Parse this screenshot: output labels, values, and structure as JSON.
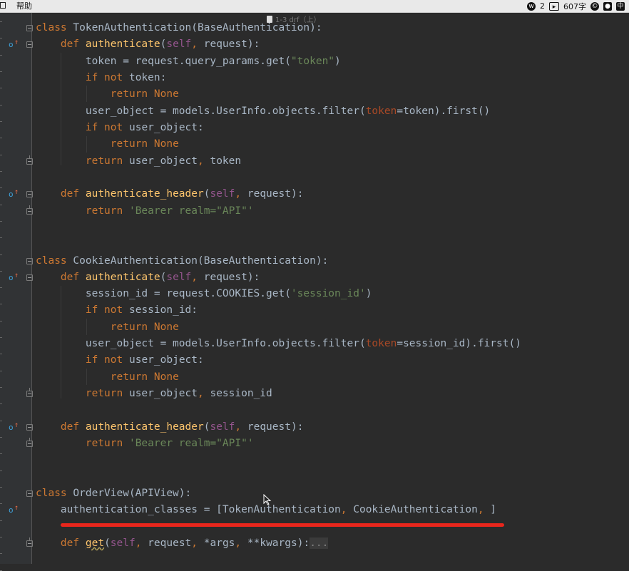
{
  "menubar": {
    "help_label": "帮助",
    "wechat_badge": "2",
    "word_count": "607字",
    "icons": [
      "window-icon",
      "wechat-icon",
      "screen-record-icon",
      "copyright-icon",
      "mic-icon",
      "input-method-icon"
    ]
  },
  "document_tab": {
    "title": "1-3 drf（上）"
  },
  "code_lines": [
    "class TokenAuthentication(BaseAuthentication):",
    "    def authenticate(self, request):",
    "        token = request.query_params.get(\"token\")",
    "        if not token:",
    "            return None",
    "        user_object = models.UserInfo.objects.filter(token=token).first()",
    "        if not user_object:",
    "            return None",
    "        return user_object, token",
    "",
    "    def authenticate_header(self, request):",
    "        return 'Bearer realm=\"API\"'",
    "",
    "",
    "class CookieAuthentication(BaseAuthentication):",
    "    def authenticate(self, request):",
    "        session_id = request.COOKIES.get('session_id')",
    "        if not session_id:",
    "            return None",
    "        user_object = models.UserInfo.objects.filter(token=session_id).first()",
    "        if not user_object:",
    "            return None",
    "        return user_object, session_id",
    "",
    "    def authenticate_header(self, request):",
    "        return 'Bearer realm=\"API\"'",
    "",
    "",
    "class OrderView(APIView):",
    "    authentication_classes = [TokenAuthentication, CookieAuthentication, ]",
    "",
    "    def get(self, request, *args, **kwargs):..."
  ],
  "colors": {
    "background": "#2b2b2b",
    "gutter": "#313335",
    "keyword": "#cc7832",
    "function": "#ffc66d",
    "self": "#94558d",
    "string": "#6a8759",
    "named_param": "#aa4926",
    "plain": "#a9b7c6",
    "annotation_underline": "#e8261c"
  }
}
